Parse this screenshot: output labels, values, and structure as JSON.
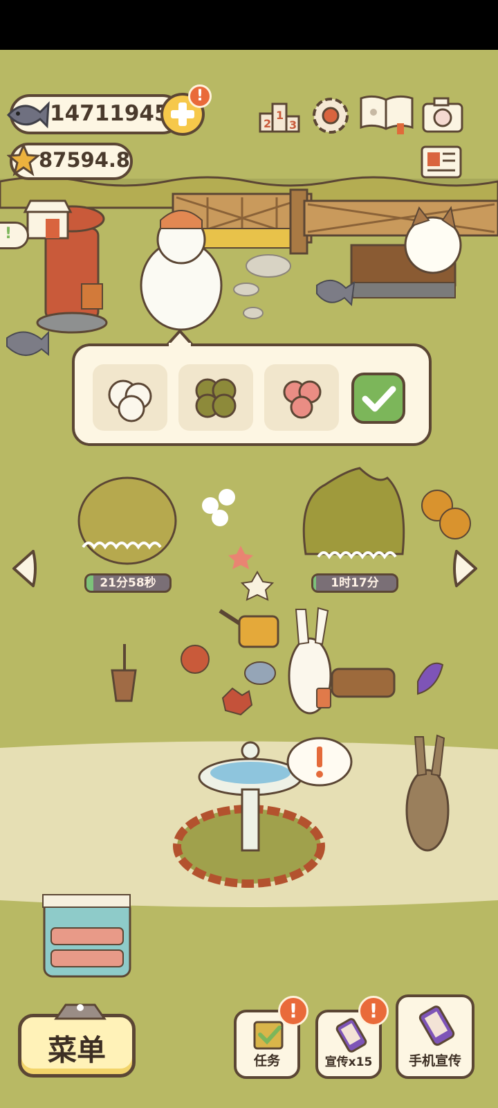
{
  "currency": {
    "fish_amount": "14711945",
    "star_amount": "87594.8",
    "alert_mark": "!"
  },
  "timers": {
    "left_plant": "21分58秒",
    "left_progress": 0.08,
    "right_plant": "1时17分",
    "right_progress": 0.03
  },
  "bottom_bar": {
    "menu_label": "菜单",
    "tasks_label": "任务",
    "promo_label": "宣传x15",
    "phone_promo_label": "手机宣传",
    "alert_mark": "!"
  },
  "colors": {
    "grass": "#b8b964",
    "path": "#e6dfb4",
    "outline": "#5b4634",
    "panel": "#fdf6e3",
    "accent_orange": "#e96a3a",
    "confirm_green": "#7cb65a",
    "menu_yellow": "#fff2b8"
  },
  "icons": [
    "fish-icon",
    "plus-icon",
    "star-icon",
    "ranking-icon",
    "gear-icon",
    "album-icon",
    "camera-icon",
    "newspaper-icon",
    "shop-icon",
    "check-icon",
    "arrow-left-icon",
    "arrow-right-icon",
    "clipboard-icon",
    "phone-icon"
  ]
}
